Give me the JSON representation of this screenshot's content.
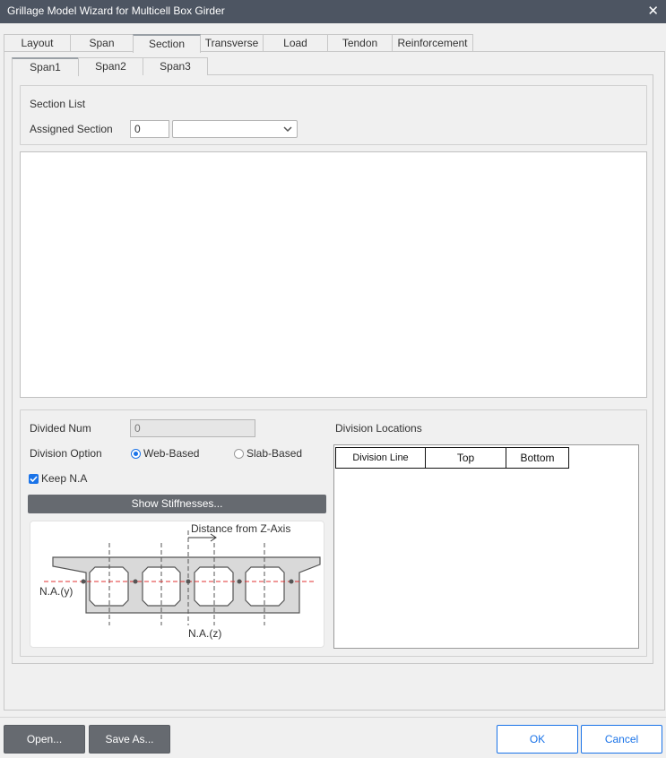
{
  "window": {
    "title": "Grillage Model Wizard for Multicell Box Girder",
    "close_glyph": "✕"
  },
  "main_tabs": [
    {
      "label": "Layout"
    },
    {
      "label": "Span"
    },
    {
      "label": "Section"
    },
    {
      "label": "Transverse"
    },
    {
      "label": "Load"
    },
    {
      "label": "Tendon"
    },
    {
      "label": "Reinforcement"
    }
  ],
  "sub_tabs": [
    {
      "label": "Span1"
    },
    {
      "label": "Span2"
    },
    {
      "label": "Span3"
    }
  ],
  "section_list": {
    "group_label": "Section List",
    "assigned_label": "Assigned Section",
    "assigned_value": "0",
    "assigned_select_value": ""
  },
  "division": {
    "divided_num_label": "Divided Num",
    "divided_num_value": "0",
    "option_label": "Division Option",
    "web_based_label": "Web-Based",
    "slab_based_label": "Slab-Based",
    "selected_option": "Web-Based",
    "keep_na_label": "Keep N.A",
    "keep_na_checked": true,
    "show_stiffness_label": "Show Stiffnesses...",
    "locations_label": "Division Locations",
    "table_headers": [
      "Division Line",
      "Top",
      "Bottom"
    ]
  },
  "diagram": {
    "distance_label": "Distance from Z-Axis",
    "na_y_label": "N.A.(y)",
    "na_z_label": "N.A.(z)"
  },
  "footer": {
    "open_label": "Open...",
    "save_as_label": "Save As...",
    "ok_label": "OK",
    "cancel_label": "Cancel"
  },
  "colors": {
    "titlebar": "#4d5562",
    "accent": "#1a73e8",
    "dark_button": "#666a70",
    "na_line": "#e03030"
  }
}
